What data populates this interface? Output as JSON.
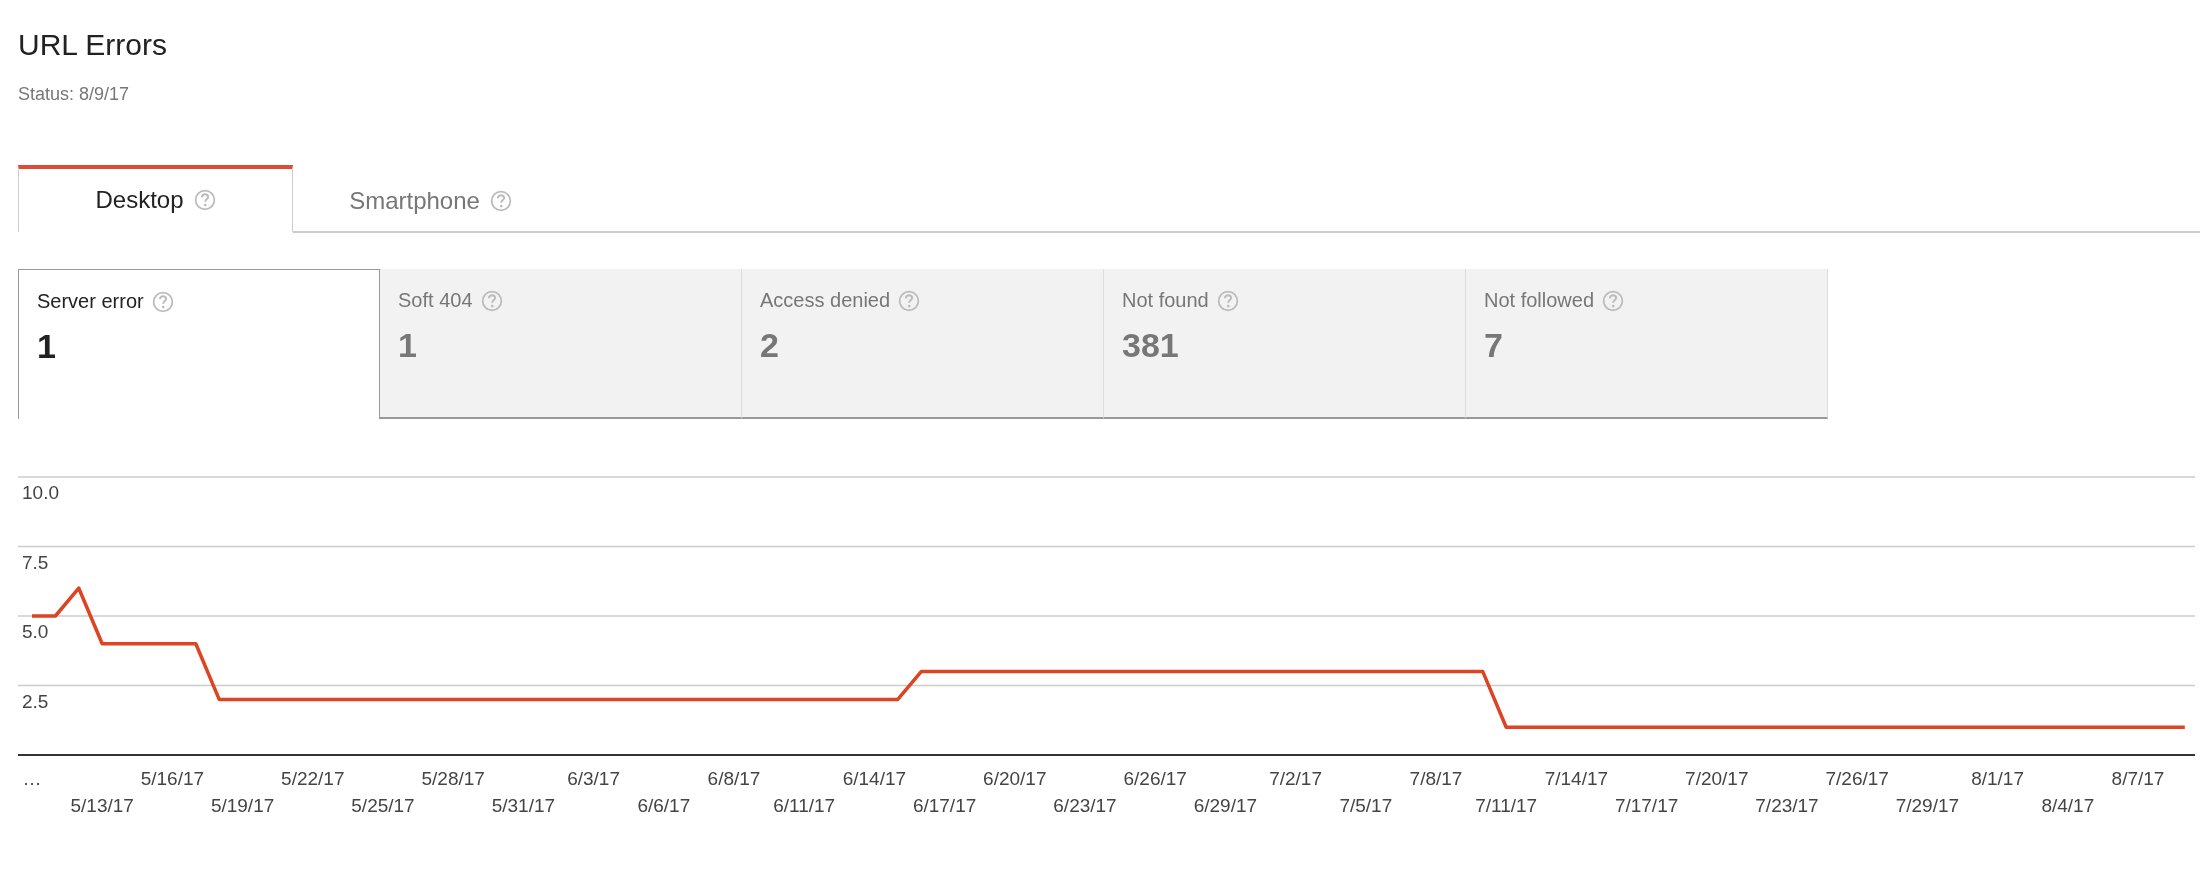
{
  "page": {
    "title": "URL Errors",
    "status": "Status: 8/9/17"
  },
  "tabs": [
    {
      "label": "Desktop",
      "selected": true
    },
    {
      "label": "Smartphone",
      "selected": false
    }
  ],
  "metrics": [
    {
      "label": "Server error",
      "value": "1",
      "selected": true
    },
    {
      "label": "Soft 404",
      "value": "1",
      "selected": false
    },
    {
      "label": "Access denied",
      "value": "2",
      "selected": false
    },
    {
      "label": "Not found",
      "value": "381",
      "selected": false
    },
    {
      "label": "Not followed",
      "value": "7",
      "selected": false
    }
  ],
  "chart_data": {
    "type": "line",
    "ylim": [
      0,
      10
    ],
    "grid": true,
    "yticks": [
      {
        "value": 2.5,
        "label": "2.5"
      },
      {
        "value": 5,
        "label": "5.0"
      },
      {
        "value": 7.5,
        "label": "7.5"
      },
      {
        "value": 10,
        "label": "10.0"
      }
    ],
    "categories": [
      "…",
      null,
      null,
      "5/13/17",
      null,
      null,
      "5/16/17",
      null,
      null,
      "5/19/17",
      null,
      null,
      "5/22/17",
      null,
      null,
      "5/25/17",
      null,
      null,
      "5/28/17",
      null,
      null,
      "5/31/17",
      null,
      null,
      "6/3/17",
      null,
      null,
      "6/6/17",
      null,
      null,
      "6/8/17",
      null,
      null,
      "6/11/17",
      null,
      null,
      "6/14/17",
      null,
      null,
      "6/17/17",
      null,
      null,
      "6/20/17",
      null,
      null,
      "6/23/17",
      null,
      null,
      "6/26/17",
      null,
      null,
      "6/29/17",
      null,
      null,
      "7/2/17",
      null,
      null,
      "7/5/17",
      null,
      null,
      "7/8/17",
      null,
      null,
      "7/11/17",
      null,
      null,
      "7/14/17",
      null,
      null,
      "7/17/17",
      null,
      null,
      "7/20/17",
      null,
      null,
      "7/23/17",
      null,
      null,
      "7/26/17",
      null,
      null,
      "7/29/17",
      null,
      null,
      "8/1/17",
      null,
      null,
      "8/4/17",
      null,
      null,
      "8/7/17",
      null,
      null
    ],
    "series": [
      {
        "color": "#dd4422",
        "values": [
          5,
          5,
          6,
          4,
          4,
          4,
          4,
          4,
          2,
          2,
          2,
          2,
          2,
          2,
          2,
          2,
          2,
          2,
          2,
          2,
          2,
          2,
          2,
          2,
          2,
          2,
          2,
          2,
          2,
          2,
          2,
          2,
          2,
          2,
          2,
          2,
          2,
          2,
          3,
          3,
          3,
          3,
          3,
          3,
          3,
          3,
          3,
          3,
          3,
          3,
          3,
          3,
          3,
          3,
          3,
          3,
          3,
          3,
          3,
          3,
          3,
          3,
          3,
          1,
          1,
          1,
          1,
          1,
          1,
          1,
          1,
          1,
          1,
          1,
          1,
          1,
          1,
          1,
          1,
          1,
          1,
          1,
          1,
          1,
          1,
          1,
          1,
          1,
          1,
          1,
          1,
          1,
          1
        ]
      }
    ]
  }
}
